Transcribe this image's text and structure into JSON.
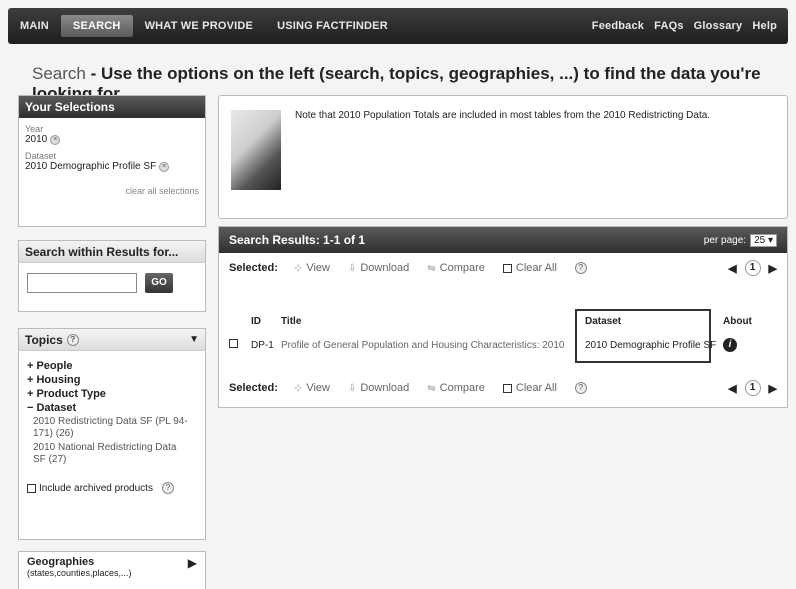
{
  "nav": {
    "items": [
      "MAIN",
      "SEARCH",
      "WHAT WE PROVIDE",
      "USING FACTFINDER"
    ],
    "right": [
      "Feedback",
      "FAQs",
      "Glossary",
      "Help"
    ]
  },
  "page_title": {
    "prefix": "Search",
    "text": " - Use the options on the left (search, topics, geographies, ...) to find the data you're looking for"
  },
  "selections": {
    "title": "Your Selections",
    "year_label": "Year",
    "year_value": "2010",
    "dataset_label": "Dataset",
    "dataset_value": "2010 Demographic Profile SF",
    "clear_all": "clear all selections"
  },
  "search_within": {
    "title": "Search within Results for...",
    "go": "GO"
  },
  "topics": {
    "title": "Topics",
    "items": [
      {
        "sign": "+",
        "label": "People"
      },
      {
        "sign": "+",
        "label": "Housing"
      },
      {
        "sign": "+",
        "label": "Product Type"
      },
      {
        "sign": "−",
        "label": "Dataset"
      }
    ],
    "subitems": [
      "2010 Redistricting Data SF (PL 94-171) (26)",
      "2010 National Redistricting Data SF (27)"
    ],
    "include_archived": "Include archived products"
  },
  "geographies": {
    "title": "Geographies",
    "subtitle": "(states,counties,places,...)"
  },
  "note": "Note that 2010 Population Totals are included in most tables from the 2010 Redistricting Data.",
  "results": {
    "title": "Search Results: 1-1 of 1",
    "per_page_label": "per page:",
    "per_page_value": "25",
    "selected_label": "Selected:",
    "actions": [
      "View",
      "Download",
      "Compare",
      "Clear All"
    ],
    "page": "1",
    "columns": [
      "ID",
      "Title",
      "Dataset",
      "About"
    ],
    "rows": [
      {
        "id": "DP-1",
        "title": "Profile of General Population and Housing Characteristics: 2010",
        "dataset": "2010 Demographic Profile SF"
      }
    ]
  }
}
